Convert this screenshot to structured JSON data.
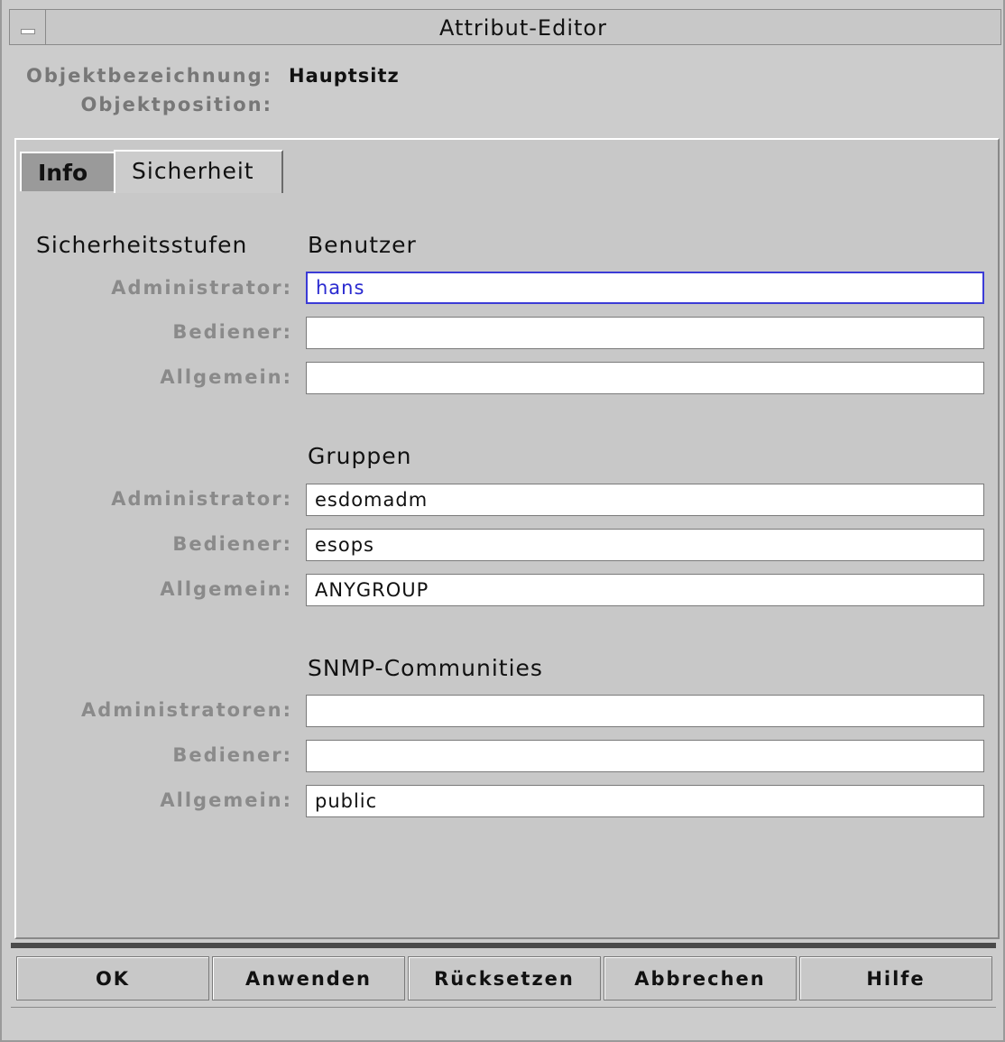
{
  "window": {
    "title": "Attribut-Editor"
  },
  "object": {
    "name_label": "Objektbezeichnung:",
    "name_value": "Hauptsitz",
    "position_label": "Objektposition:",
    "position_value": ""
  },
  "tabs": [
    {
      "label": "Info",
      "selected": false
    },
    {
      "label": "Sicherheit",
      "selected": true
    }
  ],
  "security": {
    "levels_heading": "Sicherheitsstufen",
    "users": {
      "heading": "Benutzer",
      "rows": [
        {
          "label": "Administrator:",
          "value": "hans"
        },
        {
          "label": "Bediener:",
          "value": ""
        },
        {
          "label": "Allgemein:",
          "value": ""
        }
      ]
    },
    "groups": {
      "heading": "Gruppen",
      "rows": [
        {
          "label": "Administrator:",
          "value": "esdomadm"
        },
        {
          "label": "Bediener:",
          "value": "esops"
        },
        {
          "label": "Allgemein:",
          "value": "ANYGROUP"
        }
      ]
    },
    "snmp": {
      "heading": "SNMP-Communities",
      "rows": [
        {
          "label": "Administratoren:",
          "value": ""
        },
        {
          "label": "Bediener:",
          "value": ""
        },
        {
          "label": "Allgemein:",
          "value": "public"
        }
      ]
    }
  },
  "buttons": {
    "ok": "OK",
    "apply": "Anwenden",
    "reset": "Rücksetzen",
    "cancel": "Abbrechen",
    "help": "Hilfe"
  },
  "colors": {
    "focus_border": "#3b3bd6",
    "background": "#cccccc"
  }
}
